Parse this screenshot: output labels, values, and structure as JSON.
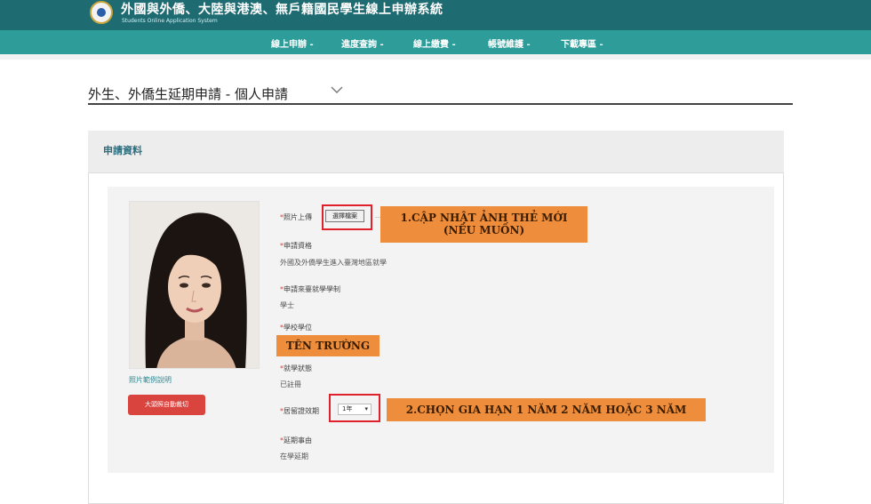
{
  "header": {
    "title": "外國與外僑、大陸與港澳、無戶籍國民學生線上申辦系統",
    "subtitle": "Students Online Application System"
  },
  "nav": {
    "items": [
      {
        "label": "線上申辦 -"
      },
      {
        "label": "進度查詢 -"
      },
      {
        "label": "線上繳費 -"
      },
      {
        "label": "帳號維護 -"
      },
      {
        "label": "下載專區 -"
      }
    ]
  },
  "page": {
    "title": "外生、外僑生延期申請 - 個人申請"
  },
  "panel": {
    "title": "申請資料"
  },
  "form": {
    "photo_label": "照片上傳",
    "photo_button": "選擇檔案",
    "qualification_label": "申請資格",
    "qualification_value": "外國及外僑學生進入臺灣地區就學",
    "degree_label": "申請來臺就學學制",
    "degree_value": "學士",
    "school_label": "學校學位",
    "status_label": "就學狀態",
    "status_value": "已註冊",
    "duration_label": "居留證效期",
    "duration_value": "1年",
    "reason_label": "延期事由",
    "reason_value": "在學延期",
    "photo_note": "照片範例說明",
    "red_button": "大頭照自動裁切"
  },
  "annotations": {
    "note1_line1": "1.CẬP NHẬT ẢNH THẺ MỚI",
    "note1_line2": "(NẾU MUỐN)",
    "note2": "TÊN TRƯỜNG",
    "note3": "2.CHỌN GIA HẠN 1 NĂM 2 NĂM HOẶC 3 NĂM"
  },
  "colors": {
    "header_bg": "#1f6b72",
    "nav_bg": "#2e9c99",
    "annotation_bg": "#ee8d3b",
    "highlight_border": "#e0202b",
    "button_red": "#d9443f"
  }
}
